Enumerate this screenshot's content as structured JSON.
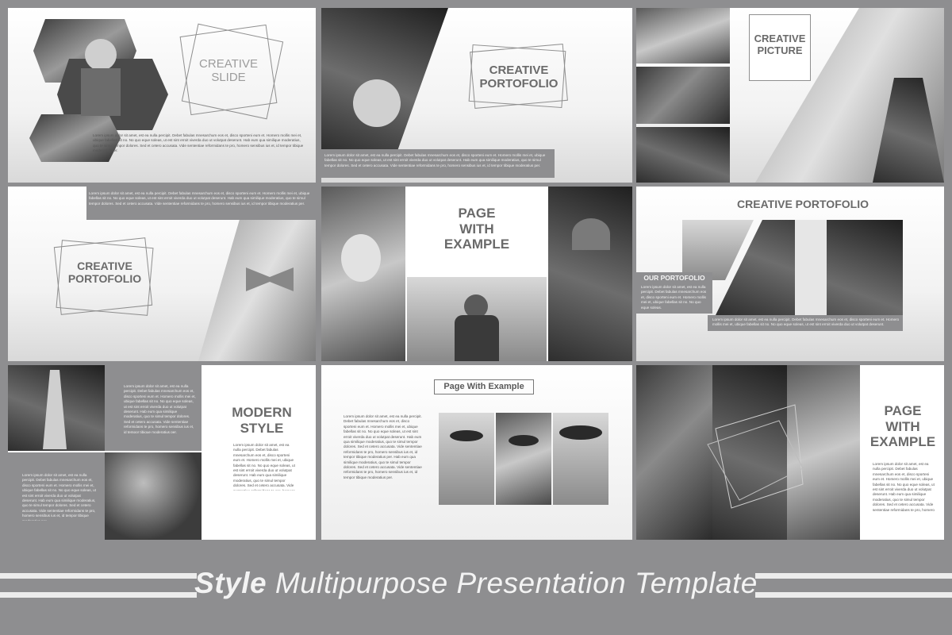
{
  "slides": {
    "creative_slide": {
      "title": "CREATIVE\nSLIDE",
      "body": "Lorem ipsum dolor sit amet, est ea nulla percipit. Debet fabulas mnesarchum eos et, disco sporteni eum et. Homero mollis mei et, ubique fabellas sit no. No quo eque soleas, ut est sint erroit viverda duo ut volutpat deserunt. Hab eum qua similique moderatius, quo te simul tempor dolores. Sed et cetero accusata. Vide sententiae reformidans te pro, homero sensibus ius et, id tempor tibique moderatius per."
    },
    "creative_portofolio_1": {
      "title": "CREATIVE\nPORTOFOLIO",
      "body": "Lorem ipsum dolor sit amet, est ea nulla percipit. Debet fabulas mnesarchum eos et, disco sporteni eum et. Homero mollis mei et, ubique fabellas sit no. No quo eque soleas, ut est sint erroit viverda duo ut volutpat deserunt. Hab eum qua similique moderatius, quo te simul tempor dolores. Sed et cetero accusata. Vide sententiae reformidans te pro, homero sensibus ius et, id tempor tibique moderatius per."
    },
    "creative_picture": {
      "title": "CREATIVE\nPICTURE"
    },
    "creative_portofolio_2": {
      "title": "CREATIVE\nPORTOFOLIO",
      "body": "Lorem ipsum dolor sit amet, est ea nulla percipit. Debet fabulas mnesarchum eos et, disco sporteni eum et. Homero mollis mei et, ubique fabellas sit no. No quo eque soleas, ut est sint erroit viverda duo ut volutpat deserunt. Hab eum qua similique moderatius, quo te simul tempor dolores. Sed et cetero accusata. Vide sententiae reformidans te pro, homero sensibus ius et, id tempor tibique moderatius per."
    },
    "page_with_example_1": {
      "title": "PAGE\nWITH\nEXAMPLE"
    },
    "creative_portofolio_3": {
      "title": "CREATIVE PORTOFOLIO",
      "subtitle": "OUR PORTOFOLIO",
      "body": "Lorem ipsum dolor sit amet, est ea nulla percipit. Debet fabulas mnesarchum eos et, disco sporteni eum et. Homero mollis mei et, ubique fabellas sit no. No quo eque soleas.",
      "body2": "Lorem ipsum dolor sit amet, est ea nulla percipit. Debet fabulas mnesarchum eos et, disco sporteni eum et. Homero mollis mei et, ubique fabellas sit no. No quo eque soleas, ut est sint erroit viverda duo ut volutpat deserunt."
    },
    "modern_style": {
      "title": "MODERN\nSTYLE",
      "body": "Lorem ipsum dolor sit amet, est ea nulla percipit. Debet fabulas mnesarchum eos et, disco sporteni eum et. Homero mollis mei et, ubique fabellas sit no. No quo eque soleas, ut est sint erroit viverda duo ut volutpat deserunt. Hab eum qua similique moderatius, quo te simul tempor dolores. Sed et cetero accusata. Vide sententiae reformidans te pro, homero sensibus ius et, id tempor tibique moderatius per.",
      "box1": "Lorem ipsum dolor sit amet, est ea nulla percipit. Debet fabulas mnesarchum eos et, disco sporteni eum et. Homero mollis mei et, ubique fabellas sit no. No quo eque soleas, ut est sint erroit viverda duo ut volutpat deserunt. Hab eum qua similique moderatius, quo te simul tempor dolores. Sed et cetero accusata. Vide sententiae reformidans te pro, homero sensibus ius et, id tempor tibique moderatius per.",
      "box2": "Lorem ipsum dolor sit amet, est ea nulla percipit. Debet fabulas mnesarchum eos et, disco sporteni eum et. Homero mollis mei et, ubique fabellas sit no. No quo eque soleas, ut est sint erroit viverda duo ut volutpat deserunt. Hab eum qua similique moderatius, quo te simul tempor dolores. Sed et cetero accusata. Vide sententiae reformidans te pro, homero sensibus ius et, id tempor tibique moderatius per."
    },
    "page_with_example_2": {
      "title": "Page With Example",
      "body": "Lorem ipsum dolor sit amet, est ea nulla percipit. Debet fabulas mnesarchum eos et, disco sporteni eum et. Homero mollis mei et, ubique fabellas sit no. No quo eque soleas, ut est sint erroit viverda duo ut volutpat deserunt. Hab eum qua similique moderatius, quo te simul tempor dolores. Sed et cetero accusata. Vide sententiae reformidans te pro, homero sensibus ius et, id tempor tibique moderatius per. Hab eum qua similique moderatius, quo te simul tempor dolores. Sed et cetero accusata. Vide sententiae reformidans te pro, homero sensibus ius et, id tempor tibique moderatius per."
    },
    "page_with_example_3": {
      "title": "PAGE\nWITH\nEXAMPLE",
      "body": "Lorem ipsum dolor sit amet, est ea nulla percipit. Debet fabulas mnesarchum eos et, disco sporteni eum et. Homero mollis mei et, ubique fabellas sit no. No quo eque soleas, ut est sint erroit viverda duo ut volutpat deserunt. Hab eum qua similique moderatius, quo te simul tempor dolores. Sed et cetero accusata. Vide sententiae reformidans te pro, homero sensibus ius et, id tempor tibique moderatius per."
    }
  },
  "footer": {
    "title_bold": "Style",
    "title_rest": " Multipurpose Presentation Template"
  },
  "colors": {
    "background": "#8e8e90",
    "title_grey": "#6a6a6a",
    "frame_grey": "#8f8f8f",
    "footer_text": "#f3f3f3"
  }
}
